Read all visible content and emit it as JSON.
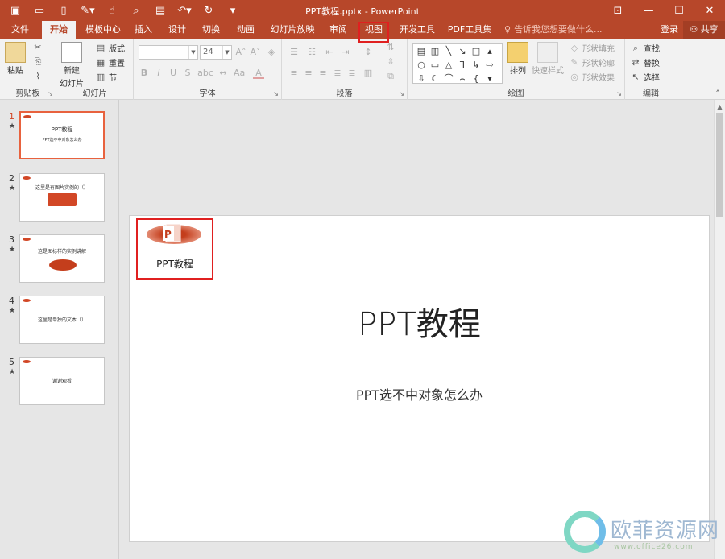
{
  "window": {
    "title": "PPT教程.pptx - PowerPoint",
    "qat": [
      "save-icon",
      "open-icon",
      "new-icon",
      "tools-icon",
      "touch-icon",
      "preview-icon",
      "present-icon",
      "undo-icon",
      "redo-icon",
      "customize-icon"
    ],
    "controls": [
      "restore-ribbon-icon",
      "minimize-icon",
      "maximize-icon",
      "close-icon"
    ]
  },
  "tabs": [
    {
      "label": "文件"
    },
    {
      "label": "开始"
    },
    {
      "label": "模板中心"
    },
    {
      "label": "插入"
    },
    {
      "label": "设计"
    },
    {
      "label": "切换"
    },
    {
      "label": "动画"
    },
    {
      "label": "幻灯片放映"
    },
    {
      "label": "审阅"
    },
    {
      "label": "视图"
    },
    {
      "label": "开发工具"
    },
    {
      "label": "PDF工具集"
    }
  ],
  "active_tab": "开始",
  "highlighted_tab": "视图",
  "tellme": "告诉我您想要做什么...",
  "login": "登录",
  "share": "共享",
  "ribbon": {
    "clipboard": {
      "label": "剪贴板",
      "paste": "粘贴"
    },
    "slides": {
      "label": "幻灯片",
      "new_slide_line1": "新建",
      "new_slide_line2": "幻灯片",
      "layout": "版式",
      "reset": "重置",
      "section": "节"
    },
    "font": {
      "label": "字体",
      "font_name": "",
      "font_size": "24"
    },
    "paragraph": {
      "label": "段落"
    },
    "drawing": {
      "label": "绘图",
      "arrange": "排列",
      "quick_styles": "快速样式",
      "shape_fill": "形状填充",
      "shape_outline": "形状轮廓",
      "shape_effects": "形状效果"
    },
    "editing": {
      "label": "编辑",
      "find": "查找",
      "replace": "替换",
      "select": "选择"
    }
  },
  "thumbnails": [
    {
      "num": "1",
      "star": "★",
      "title": "PPT教程",
      "subtitle": "PPT选不中对象怎么办"
    },
    {
      "num": "2",
      "star": "★",
      "text": "这里是有图片实例的（）"
    },
    {
      "num": "3",
      "star": "★",
      "text": "这是图标样的实例讲解"
    },
    {
      "num": "4",
      "star": "★",
      "text": "这里是单独的文本（）"
    },
    {
      "num": "5",
      "star": "★",
      "text": "谢谢观看"
    }
  ],
  "slide": {
    "logo_caption": "PPT教程",
    "title": "PPT教程",
    "subtitle": "PPT选不中对象怎么办"
  },
  "watermark": {
    "text": "欧菲资源网",
    "url": "www.office26.com"
  }
}
